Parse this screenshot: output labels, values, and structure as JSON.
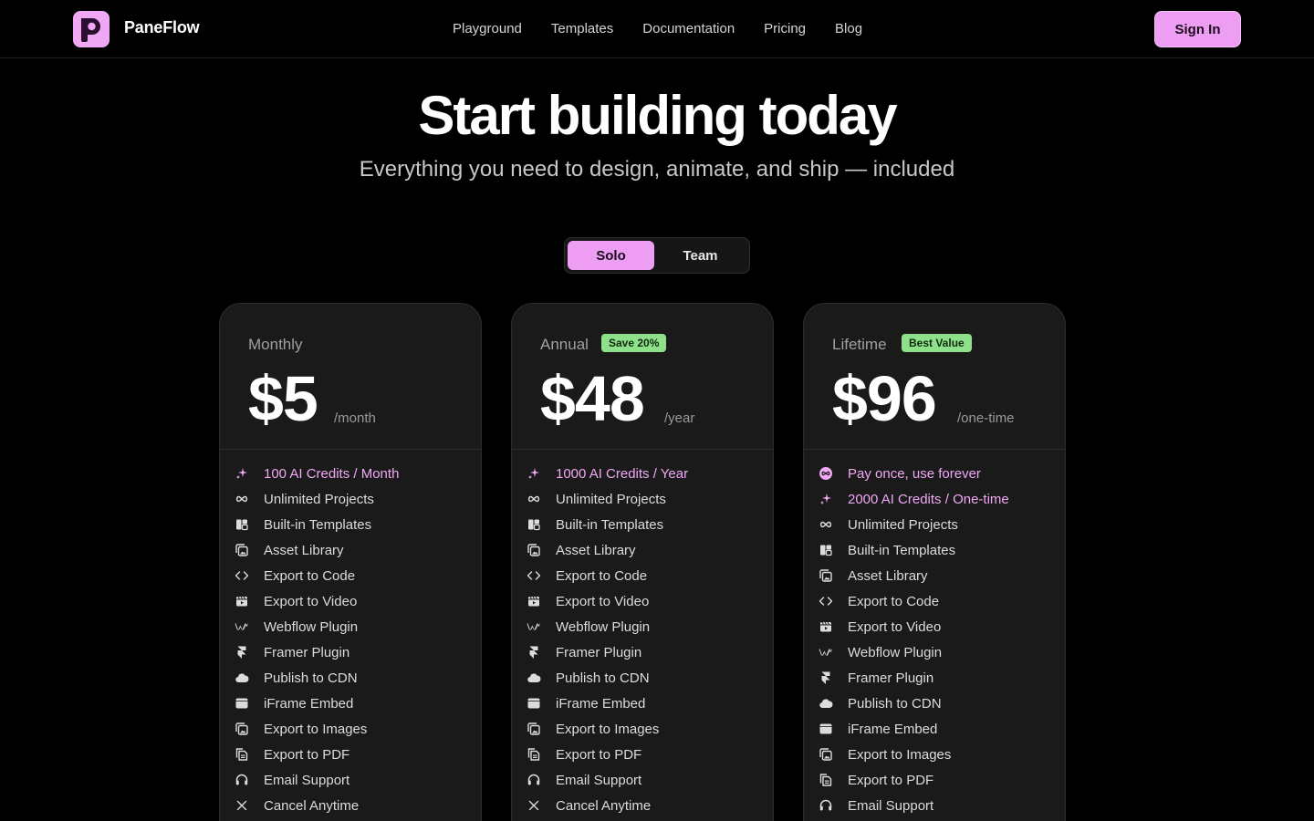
{
  "header": {
    "brand": "PaneFlow",
    "nav": [
      "Playground",
      "Templates",
      "Documentation",
      "Pricing",
      "Blog"
    ],
    "signin_label": "Sign In"
  },
  "hero": {
    "title": "Start building today",
    "subtitle": "Everything you need to design, animate, and ship — included"
  },
  "toggle": {
    "options": [
      "Solo",
      "Team"
    ],
    "selected": "Solo"
  },
  "colors": {
    "accent": "#ee9ef2",
    "badge": "#8fe08a",
    "background": "#000000",
    "card": "#1a1a1a"
  },
  "plans": [
    {
      "name": "Monthly",
      "badge": "",
      "price": "$5",
      "period": "/month",
      "features": [
        {
          "icon": "sparkle-icon",
          "label": "100 AI Credits / Month",
          "highlight": true
        },
        {
          "icon": "infinity-icon",
          "label": "Unlimited Projects",
          "highlight": false
        },
        {
          "icon": "template-icon",
          "label": "Built-in Templates",
          "highlight": false
        },
        {
          "icon": "library-icon",
          "label": "Asset Library",
          "highlight": false
        },
        {
          "icon": "code-icon",
          "label": "Export to Code",
          "highlight": false
        },
        {
          "icon": "video-icon",
          "label": "Export to Video",
          "highlight": false
        },
        {
          "icon": "webflow-icon",
          "label": "Webflow Plugin",
          "highlight": false
        },
        {
          "icon": "framer-icon",
          "label": "Framer Plugin",
          "highlight": false
        },
        {
          "icon": "cloud-icon",
          "label": "Publish to CDN",
          "highlight": false
        },
        {
          "icon": "window-icon",
          "label": "iFrame Embed",
          "highlight": false
        },
        {
          "icon": "images-icon",
          "label": "Export to Images",
          "highlight": false
        },
        {
          "icon": "pdf-icon",
          "label": "Export to PDF",
          "highlight": false
        },
        {
          "icon": "headset-icon",
          "label": "Email Support",
          "highlight": false
        },
        {
          "icon": "close-icon",
          "label": "Cancel Anytime",
          "highlight": false
        }
      ]
    },
    {
      "name": "Annual",
      "badge": "Save 20%",
      "price": "$48",
      "period": "/year",
      "features": [
        {
          "icon": "sparkle-icon",
          "label": "1000 AI Credits / Year",
          "highlight": true
        },
        {
          "icon": "infinity-icon",
          "label": "Unlimited Projects",
          "highlight": false
        },
        {
          "icon": "template-icon",
          "label": "Built-in Templates",
          "highlight": false
        },
        {
          "icon": "library-icon",
          "label": "Asset Library",
          "highlight": false
        },
        {
          "icon": "code-icon",
          "label": "Export to Code",
          "highlight": false
        },
        {
          "icon": "video-icon",
          "label": "Export to Video",
          "highlight": false
        },
        {
          "icon": "webflow-icon",
          "label": "Webflow Plugin",
          "highlight": false
        },
        {
          "icon": "framer-icon",
          "label": "Framer Plugin",
          "highlight": false
        },
        {
          "icon": "cloud-icon",
          "label": "Publish to CDN",
          "highlight": false
        },
        {
          "icon": "window-icon",
          "label": "iFrame Embed",
          "highlight": false
        },
        {
          "icon": "images-icon",
          "label": "Export to Images",
          "highlight": false
        },
        {
          "icon": "pdf-icon",
          "label": "Export to PDF",
          "highlight": false
        },
        {
          "icon": "headset-icon",
          "label": "Email Support",
          "highlight": false
        },
        {
          "icon": "close-icon",
          "label": "Cancel Anytime",
          "highlight": false
        }
      ]
    },
    {
      "name": "Lifetime",
      "badge": "Best Value",
      "price": "$96",
      "period": "/one-time",
      "features": [
        {
          "icon": "forever-icon",
          "label": "Pay once, use forever",
          "highlight": true
        },
        {
          "icon": "sparkle-icon",
          "label": "2000 AI Credits / One-time",
          "highlight": true
        },
        {
          "icon": "infinity-icon",
          "label": "Unlimited Projects",
          "highlight": false
        },
        {
          "icon": "template-icon",
          "label": "Built-in Templates",
          "highlight": false
        },
        {
          "icon": "library-icon",
          "label": "Asset Library",
          "highlight": false
        },
        {
          "icon": "code-icon",
          "label": "Export to Code",
          "highlight": false
        },
        {
          "icon": "video-icon",
          "label": "Export to Video",
          "highlight": false
        },
        {
          "icon": "webflow-icon",
          "label": "Webflow Plugin",
          "highlight": false
        },
        {
          "icon": "framer-icon",
          "label": "Framer Plugin",
          "highlight": false
        },
        {
          "icon": "cloud-icon",
          "label": "Publish to CDN",
          "highlight": false
        },
        {
          "icon": "window-icon",
          "label": "iFrame Embed",
          "highlight": false
        },
        {
          "icon": "images-icon",
          "label": "Export to Images",
          "highlight": false
        },
        {
          "icon": "pdf-icon",
          "label": "Export to PDF",
          "highlight": false
        },
        {
          "icon": "headset-icon",
          "label": "Email Support",
          "highlight": false
        }
      ]
    }
  ]
}
